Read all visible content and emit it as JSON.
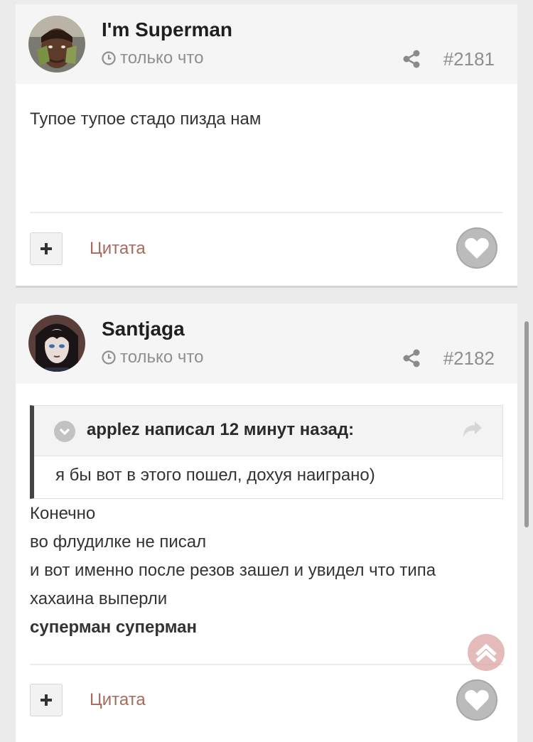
{
  "posts": [
    {
      "author": "I'm Superman",
      "time": "только что",
      "post_number": "#2181",
      "quote": null,
      "content": [
        "Тупое тупое стадо пизда нам"
      ],
      "content_bold": "",
      "quote_label": "Цитата"
    },
    {
      "author": "Santjaga",
      "time": "только что",
      "post_number": "#2182",
      "quote": {
        "citation": "applez написал 12 минут назад:",
        "text": "я бы вот в этого пошел, дохуя наиграно)"
      },
      "content": [
        "Конечно",
        "во флудилке не писал",
        "и вот именно после резов зашел и увидел что типа",
        "хахаина выперли"
      ],
      "content_bold": "суперман суперман",
      "quote_label": "Цитата"
    }
  ],
  "icons": {
    "time": "clock-icon",
    "share": "share-icon",
    "plus": "plus-icon",
    "like": "heart-icon",
    "quote_toggle": "chevron-down-icon",
    "quote_goto": "reply-arrow-icon",
    "scroll_top": "chevron-up-icon"
  },
  "colors": {
    "quote_link": "#a86a5d",
    "like_button": "#bbbbbb",
    "scroll_top_button": "#daa0a0"
  }
}
